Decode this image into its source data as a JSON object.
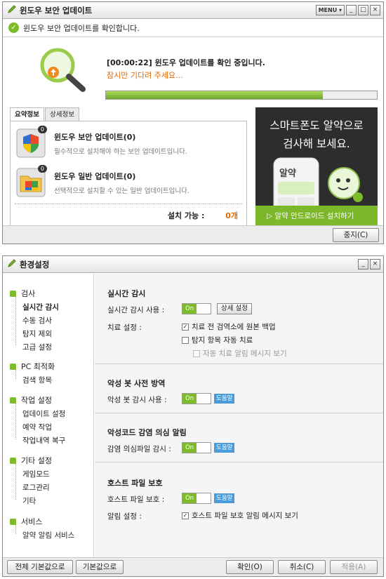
{
  "update_window": {
    "title": "윈도우 보안 업데이트",
    "menu_label": "MENU ▾",
    "status_message": "윈도우 보안 업데이트를 확인합니다.",
    "progress_text": "[00:00:22]  윈도우 업데이트를 확인 중입니다.",
    "wait_text": "잠시만 기다려 주세요...",
    "progress_value": 0.8,
    "tabs": [
      {
        "label": "요약정보",
        "active": true
      },
      {
        "label": "상세정보",
        "active": false
      }
    ],
    "items": [
      {
        "name": "윈도우 보안 업데이트(0)",
        "desc": "필수적으로 설치해야 하는 보안 업데이트입니다.",
        "badge": "0",
        "icon": "shield-icon"
      },
      {
        "name": "윈도우 일반 업데이트(0)",
        "desc": "선택적으로 설치할 수 있는 일반 업데이트입니다.",
        "badge": "0",
        "icon": "folder-icon"
      }
    ],
    "installable_label": "설치 가능 :",
    "installable_count": "0개",
    "ad": {
      "line1": "스마트폰도 알약으로",
      "line2": "검사해 보세요.",
      "app_name": "알약",
      "cta": "알약 안드로이드 설치하기"
    },
    "stop_button": "중지(C)"
  },
  "settings_window": {
    "title": "환경설정",
    "nav": [
      {
        "label": "검사",
        "children": [
          "실시간 감시",
          "수동 검사",
          "탐지 제외",
          "고급 설정"
        ]
      },
      {
        "label": "PC 최적화",
        "children": [
          "검색 항목"
        ]
      },
      {
        "label": "작업 설정",
        "children": [
          "업데이트 설정",
          "예약 작업",
          "작업내역 복구"
        ]
      },
      {
        "label": "기타 설정",
        "children": [
          "게임모드",
          "로그관리",
          "기타"
        ]
      },
      {
        "label": "서비스",
        "children": [
          "알약 알림 서비스"
        ]
      }
    ],
    "selected_nav": "실시간 감시",
    "sections": {
      "realtime": {
        "title": "실시간 감시",
        "use_label": "실시간 감시 사용 :",
        "toggle": "On",
        "detail_button": "상세 설정",
        "treatment_label": "치료 설정 :",
        "options": [
          {
            "label": "치료 전 검역소에 원본 백업",
            "checked": true,
            "disabled": false
          },
          {
            "label": "탐지 항목 자동 치료",
            "checked": false,
            "disabled": false
          },
          {
            "label": "자동 치료 알림 메시지 보기",
            "checked": false,
            "disabled": true
          }
        ]
      },
      "bot": {
        "title": "악성 봇 사전 방역",
        "use_label": "악성 봇 감시 사용 :",
        "toggle": "On",
        "help": "도움말"
      },
      "suspicious": {
        "title": "악성코드 감염 의심 알림",
        "use_label": "감염 의심파일 감시 :",
        "toggle": "On",
        "help": "도움말"
      },
      "hosts": {
        "title": "호스트 파일 보호",
        "use_label": "호스트 파일 보호 :",
        "toggle": "On",
        "help": "도움말",
        "alert_label": "알림 설정 :",
        "alert_option": {
          "label": "호스트 파일 보호 알림 메시지 보기",
          "checked": true
        }
      }
    },
    "buttons": {
      "reset_all": "전체 기본값으로",
      "reset": "기본값으로",
      "ok": "확인(O)",
      "cancel": "취소(C)",
      "apply": "적용(A)"
    }
  },
  "colors": {
    "accent_green": "#7dbb2a",
    "progress_orange": "#e06a00",
    "help_blue": "#4a9bd8"
  }
}
